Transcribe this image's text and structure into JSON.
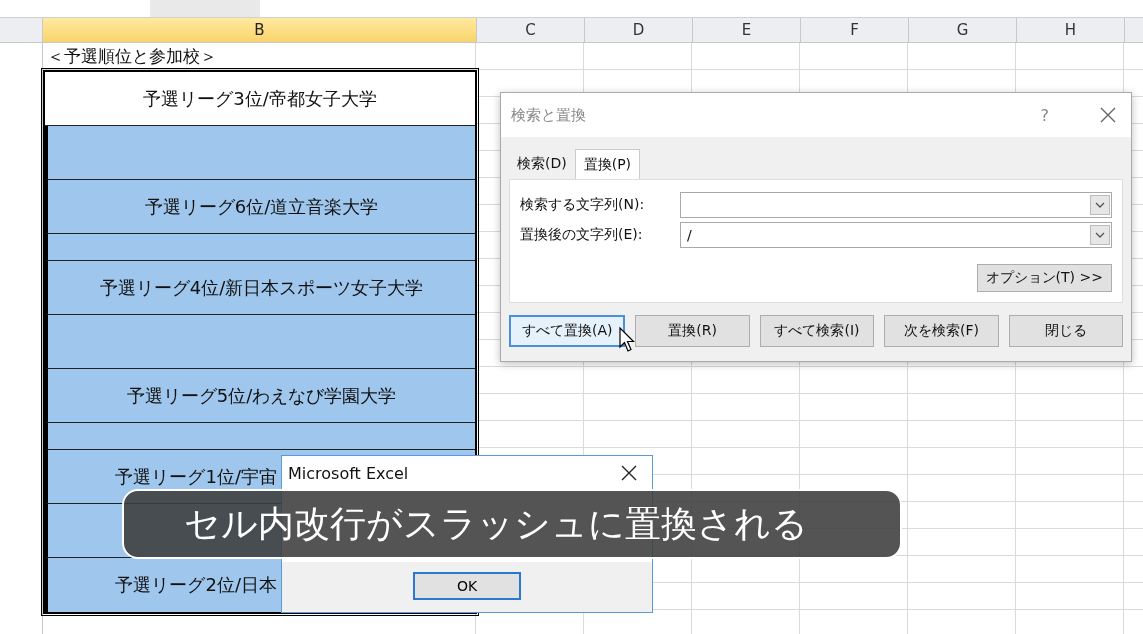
{
  "columns": [
    {
      "label": "B",
      "selected": true
    },
    {
      "label": "C",
      "selected": false
    },
    {
      "label": "D",
      "selected": false
    },
    {
      "label": "E",
      "selected": false
    },
    {
      "label": "F",
      "selected": false
    },
    {
      "label": "G",
      "selected": false
    },
    {
      "label": "H",
      "selected": false
    }
  ],
  "sheet_title": "＜予選順位と参加校＞",
  "table_rows": [
    {
      "text": "予選リーグ3位/帝都女子大学",
      "kind": "tall",
      "selected": false
    },
    {
      "kind": "tall",
      "selected": true
    },
    {
      "text": "予選リーグ6位/道立音楽大学",
      "kind": "tall",
      "selected": true
    },
    {
      "kind": "short",
      "selected": true
    },
    {
      "text": "予選リーグ4位/新日本スポーツ女子大学",
      "kind": "tall",
      "selected": true
    },
    {
      "kind": "tall",
      "selected": true
    },
    {
      "text": "予選リーグ5位/わえなび学園大学",
      "kind": "tall",
      "selected": true
    },
    {
      "kind": "short",
      "selected": true
    },
    {
      "text": "予選リーグ1位/宇宙",
      "kind": "tall-under-box",
      "selected": true
    },
    {
      "kind": "tall",
      "selected": true
    },
    {
      "text": "予選リーグ2位/日本",
      "kind": "tall-under-box",
      "selected": true
    }
  ],
  "find_dialog": {
    "title": "検索と置換",
    "help": "?",
    "tabs": [
      {
        "label": "検索(D)",
        "selected": false
      },
      {
        "label": "置換(P)",
        "selected": true
      }
    ],
    "fields": [
      {
        "label": "検索する文字列(N):"
      },
      {
        "label": "置換後の文字列(E):",
        "value": "/"
      }
    ],
    "options_button": "オプション(T) >>",
    "buttons": [
      {
        "label": "すべて置換(A)",
        "focused": true
      },
      {
        "label": "置換(R)",
        "focused": false
      },
      {
        "label": "すべて検索(I)",
        "focused": false
      },
      {
        "label": "次を検索(F)",
        "focused": false
      },
      {
        "label": "閉じる",
        "focused": false
      }
    ]
  },
  "message_box": {
    "title": "Microsoft Excel",
    "button": "OK"
  },
  "caption": "セル内改行がスラッシュに置換される"
}
